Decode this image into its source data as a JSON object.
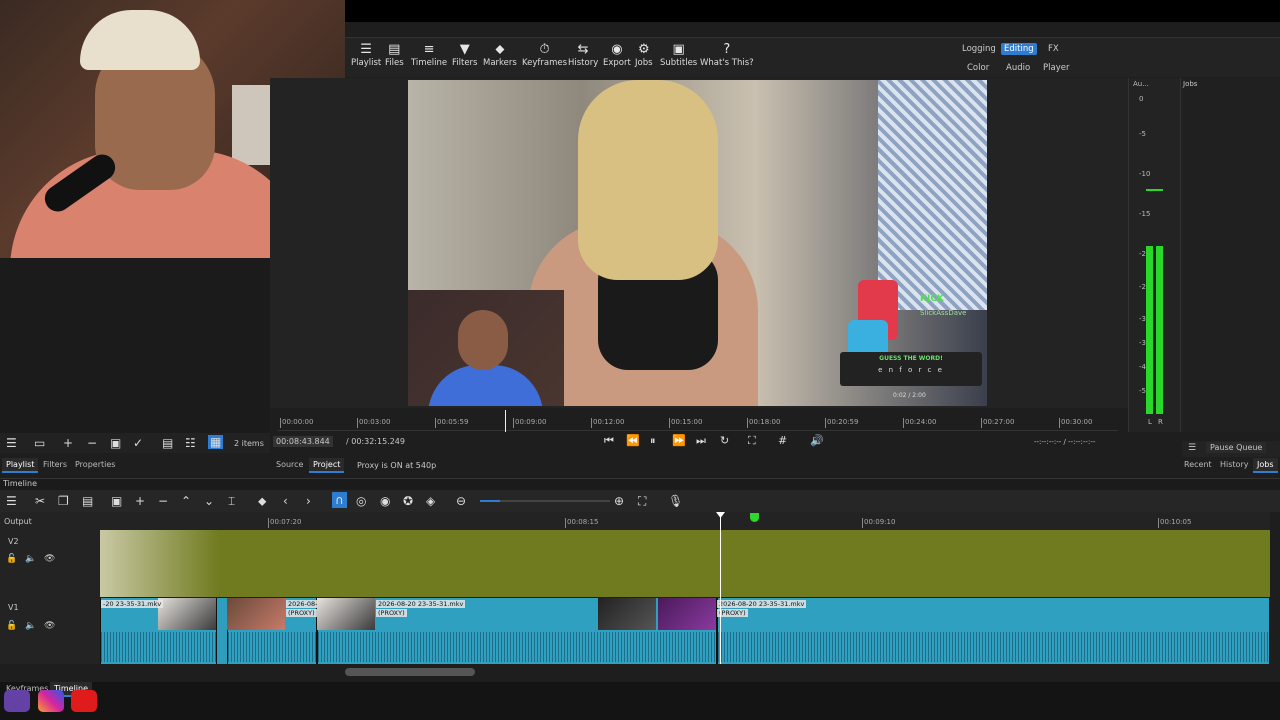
{
  "toolbar": {
    "items": [
      "Playlist",
      "Files",
      "Timeline",
      "Filters",
      "Markers",
      "Keyframes",
      "History",
      "Export",
      "Jobs",
      "Subtitles",
      "What's This?"
    ],
    "layouts_top": [
      "Logging",
      "Editing",
      "FX"
    ],
    "layouts_bottom": [
      "Color",
      "Audio",
      "Player"
    ],
    "active_layout": "Editing"
  },
  "video_overlay": {
    "kick": "KICK",
    "kick_handle": "SlickAssDave",
    "guess_title": "GUESS THE WORD!",
    "guess_word": "e n f o r c e",
    "video_time": "0:02 / 2:00"
  },
  "audio_meter": {
    "title": "Au...",
    "scale": [
      "0",
      "-5",
      "-10",
      "-15",
      "-20",
      "-25",
      "-30",
      "-35",
      "-40",
      "-50"
    ],
    "channels": [
      "L",
      "R"
    ]
  },
  "jobs": {
    "title": "Jobs",
    "pause_label": "Pause Queue",
    "tabs": [
      "Recent",
      "History",
      "Jobs"
    ]
  },
  "ruler": {
    "ticks": [
      "00:00:00",
      "00:03:00",
      "00:05:59",
      "00:09:00",
      "00:12:00",
      "00:15:00",
      "00:18:00",
      "00:20:59",
      "00:24:00",
      "00:27:00",
      "00:30:00"
    ]
  },
  "transport": {
    "position": "00:08:43.844",
    "duration": "/ 00:32:15.249",
    "in_out": "--:--:--:-- / --:--:--:--",
    "proxy": "Proxy is ON at 540p",
    "tabs": [
      "Source",
      "Project"
    ]
  },
  "playlist": {
    "count": "2 items",
    "tabs": [
      "Playlist",
      "Filters",
      "Properties"
    ]
  },
  "timeline": {
    "title": "Timeline",
    "output": "Output",
    "tracks": [
      "V2",
      "V1"
    ],
    "ruler": [
      "00:07:20",
      "00:08:15",
      "00:09:10",
      "00:10:05"
    ],
    "clips": [
      {
        "name": "-20 23-35-31.mkv"
      },
      {
        "name": "2026-08-"
      },
      {
        "name": "2026-08-20 23-35-31.mkv",
        "sub": "(PROXY)"
      },
      {
        "name": "2026-08-20 23-35-31.mkv",
        "sub": "(PROXY)"
      }
    ],
    "proxy_tag": "(PROXY)"
  },
  "bottom_tabs": [
    "Keyframes",
    "Timeline"
  ],
  "colors": {
    "accent": "#2f7dd1",
    "v2_track": "#707a1f",
    "v1_track": "#2f9dbe"
  }
}
